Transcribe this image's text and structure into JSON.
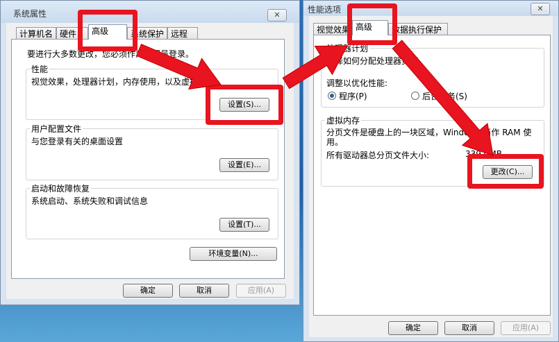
{
  "left_window": {
    "title": "系统属性",
    "close": "✕",
    "tabs": [
      "计算机名",
      "硬件",
      "高级",
      "系统保护",
      "远程"
    ],
    "intro": "要进行大多数更改，您必须作为管理员登录。",
    "performance": {
      "title": "性能",
      "desc": "视觉效果，处理器计划，内存使用，以及虚拟内存",
      "button": "设置(S)..."
    },
    "profile": {
      "title": "用户配置文件",
      "desc": "与您登录有关的桌面设置",
      "button": "设置(E)..."
    },
    "startup": {
      "title": "启动和故障恢复",
      "desc": "系统启动、系统失败和调试信息",
      "button": "设置(T)..."
    },
    "env_button": "环境变量(N)...",
    "ok": "确定",
    "cancel": "取消",
    "apply": "应用(A)"
  },
  "right_window": {
    "title": "性能选项",
    "close": "✕",
    "tabs": [
      "视觉效果",
      "高级",
      "数据执行保护"
    ],
    "scheduling": {
      "title": "处理器计划",
      "desc": "选择如何分配处理器资源。",
      "adjust_label": "调整以优化性能:",
      "option1": "程序(P)",
      "option2": "后台服务(S)"
    },
    "virtual_memory": {
      "title": "虚拟内存",
      "desc_line1": "分页文件是硬盘上的一块区域，Windows 当作 RAM 使",
      "desc_line2": "用。",
      "total_label": "所有驱动器总分页文件大小:",
      "total_value": "3392 MB",
      "button": "更改(C)..."
    },
    "ok": "确定",
    "cancel": "取消",
    "apply": "应用(A)"
  },
  "annotation_color": "#e8141f"
}
